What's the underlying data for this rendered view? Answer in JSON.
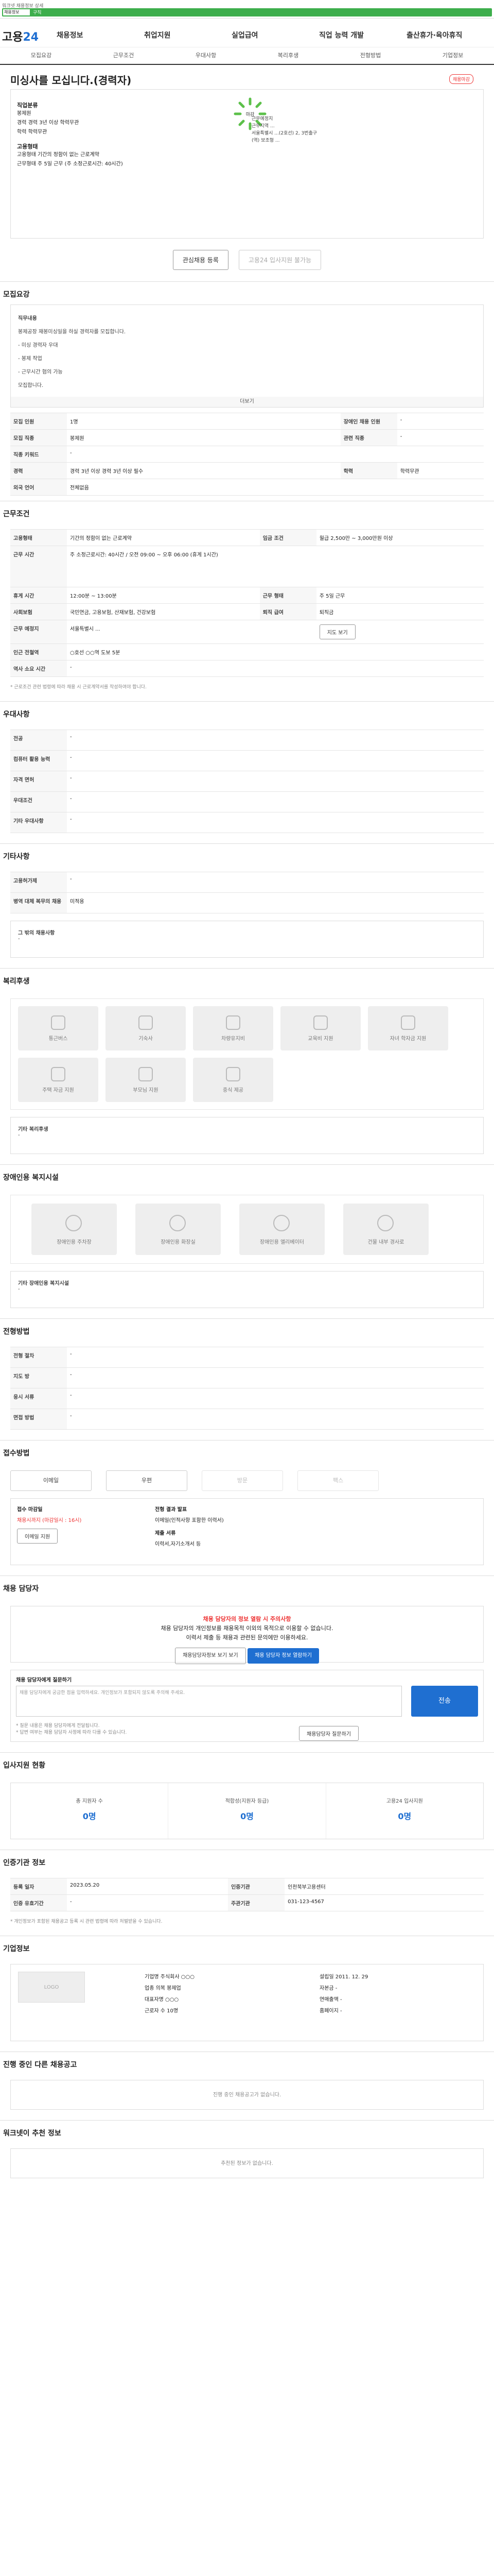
{
  "top": {
    "breadcrumb": "워크넷 채용정보 상세",
    "tab_label": "채용정보",
    "nav_label": "구직"
  },
  "header": {
    "logo_main": "고용",
    "logo_accent": "24",
    "menu": [
      "채용정보",
      "취업지원",
      "실업급여",
      "직업 능력 개발",
      "출산휴가·육아휴직"
    ]
  },
  "subnav": [
    "모집요강",
    "근무조건",
    "우대사항",
    "복리후생",
    "전형방법",
    "기업정보"
  ],
  "job": {
    "title": "미싱사를 모십니다.(경력자)",
    "badge": "채용마감",
    "company": "",
    "ring_label": "마감",
    "ring_lines": [
      "근무지역 ...",
      "서울특별시 ...(2호선) 2, 3번출구",
      "(역) 보조형 ..."
    ],
    "info": [
      {
        "label": "직업분류",
        "lines": [
          "봉제원",
          "경력  경력 3년 이상  학력무관",
          "학력  학력무관"
        ]
      },
      {
        "label": "고용형태",
        "lines": [
          "고용형태  기간의 정함이 없는 근로계약",
          "근무형태  주 5일 근무 (주 소정근로시간: 40시간)"
        ]
      }
    ],
    "work_area_label": "근무예정지"
  },
  "actions": {
    "save": "관심채용 등록",
    "apply": "고용24 입사지원 불가능"
  },
  "recruit": {
    "heading": "모집요강",
    "desc_label": "직무내용",
    "desc_lines": [
      "봉제공장 재봉미싱일을 하실 경력자를 모집합니다.",
      "- 미싱 경력자 우대",
      "- 봉제 작업",
      "- 근무시간 협의 가능",
      "모집합니다.",
      "정원 ○명 모집"
    ],
    "more": "더보기",
    "rows": [
      [
        "모집 인원",
        "1명",
        "장애인 채용 인원",
        "-"
      ],
      [
        "모집 직종",
        "봉제원",
        "관련 직종",
        "-"
      ],
      [
        "직종 키워드",
        "-",
        "",
        ""
      ],
      [
        "경력",
        "경력 3년 이상  경력 3년 이상 필수",
        "학력",
        "학력무관"
      ],
      [
        "외국 언어",
        "전체없음",
        "",
        ""
      ]
    ]
  },
  "condition": {
    "heading": "근무조건",
    "rows": [
      [
        "고용형태",
        "기간의 정함이 없는 근로계약",
        "임금 조건",
        "월급 2,500만 ~ 3,000만원 이상"
      ],
      [
        "근무 시간",
        "주 소정근로시간: 40시간  /  오전 09:00 ~ 오후 06:00 (휴게 1시간)",
        "",
        ""
      ],
      [
        "휴게 시간",
        "12:00분 ~ 13:00분",
        "근무 형태",
        "주 5일 근무"
      ],
      [
        "사회보험",
        "국민연금, 고용보험, 산재보험, 건강보험",
        "퇴직 급여",
        "퇴직금"
      ],
      [
        "근무 예정지",
        "서울특별시 ...",
        "",
        ""
      ],
      [
        "인근 전철역",
        "○호선 ○○역 도보 5분",
        "",
        ""
      ],
      [
        "역사 소요 시간",
        "-",
        "",
        ""
      ]
    ],
    "map_btn": "지도 보기",
    "note": "* 근로조건 관련 법령에 따라 채용 시 근로계약서를 작성하여야 합니다."
  },
  "prefer": {
    "heading": "우대사항",
    "rows": [
      [
        "전공",
        "-"
      ],
      [
        "컴퓨터 활용 능력",
        "-"
      ],
      [
        "자격 면허",
        "-"
      ],
      [
        "우대조건",
        "-"
      ],
      [
        "기타 우대사항",
        "-"
      ]
    ]
  },
  "etc": {
    "heading": "기타사항",
    "rows": [
      [
        "고용허가제",
        "-"
      ],
      [
        "병역 대체 복무의 채용",
        "미적용"
      ]
    ],
    "other_label": "그 밖의 채용사항",
    "other_value": "-"
  },
  "welfare": {
    "heading": "복리후생",
    "cards": [
      "통근버스",
      "기숙사",
      "차량유지비",
      "교육비 지원",
      "자녀 학자금 지원",
      "주택 자금 지원",
      "부모님 지원",
      "중식 제공"
    ],
    "extra_label": "기타 복리후생",
    "extra_value": "-"
  },
  "facility": {
    "heading": "장애인용 복지시설",
    "cards": [
      "장애인용 주차장",
      "장애인용 화장실",
      "장애인용 엘리베이터",
      "건물 내부 경사로"
    ],
    "extra_label": "기타 장애인용 복지시설",
    "extra_value": "-"
  },
  "selection": {
    "heading": "전형방법",
    "rows": [
      [
        "전형 절차",
        "-"
      ],
      [
        "지도 방",
        "-"
      ],
      [
        "응시 서류",
        "-"
      ],
      [
        "면접 방법",
        "-"
      ]
    ]
  },
  "apply": {
    "heading": "접수방법",
    "methods": [
      "이메일",
      "우편",
      "방문",
      "팩스"
    ],
    "deadline_label": "접수 마감일",
    "deadline_value": "채용시까지 (마감일시 : 16시)",
    "result_label": "전형 결과 발표",
    "result_value": "이메일(인적사항 포함한 이력서)",
    "submit_label": "제출 서류",
    "submit_value": "이력서,자기소개서 등",
    "apply_btn": "이메일 지원"
  },
  "manager": {
    "heading": "채용 담당자",
    "alert_title": "채용 담당자의 정보 열람 시 주의사항",
    "alert_lines": [
      "채용 담당자의 개인정보를 채용목적 이외의 목적으로 이용할 수 없습니다.",
      "이력서 제출 등 채용과 관련된 문의에만 이용하세요."
    ],
    "btn_view": "채용담당자정보 보기 보기",
    "btn_contact": "채용 담당자 정보 열람하기"
  },
  "question": {
    "heading": "채용 담당자에게 질문하기",
    "placeholder": "채용 담당자에게 궁금한 점을 입력하세요. 개인정보가 포함되지 않도록 주의해 주세요.",
    "submit": "전송",
    "notes": [
      "* 질문 내용은 채용 담당자에게 전달됩니다.",
      "* 답변 여부는 채용 담당자 사정에 따라 다를 수 있습니다."
    ],
    "btn": "채용담당자 질문하기"
  },
  "status": {
    "heading": "입사지원 현황",
    "items": [
      {
        "label": "총 지원자 수",
        "value": "0명"
      },
      {
        "label": "적합성(지원자 등급)",
        "value": "0명"
      },
      {
        "label": "고용24 입사지원",
        "value": "0명"
      }
    ]
  },
  "posting": {
    "heading": "인증기관 정보",
    "rows": [
      [
        "등록 일자",
        "2023.05.20",
        "인증기관",
        "인천북부고용센터"
      ],
      [
        "인증 유효기간",
        "-",
        "주관기관",
        "031-123-4567"
      ]
    ],
    "note": "* 개인정보가 포함된 채용공고 등록 시 관련 법령에 따라 처벌받을 수 있습니다."
  },
  "company_info": {
    "heading": "기업정보",
    "logo_text": "LOGO",
    "rows": [
      "기업명  주식회사 ○○○",
      "업종  의복 봉제업",
      "대표자명  ○○○",
      "근로자 수  10명"
    ],
    "rows2": [
      "설립일  2011. 12. 29",
      "자본금  -",
      "연매출액  -",
      "홈페이지  -"
    ]
  },
  "similar": {
    "heading": "진행 중인 다른 채용공고",
    "empty": "진행 중인 채용공고가 없습니다."
  },
  "recommend": {
    "heading": "워크넷이 추천 정보",
    "empty": "추천된 정보가 없습니다."
  }
}
